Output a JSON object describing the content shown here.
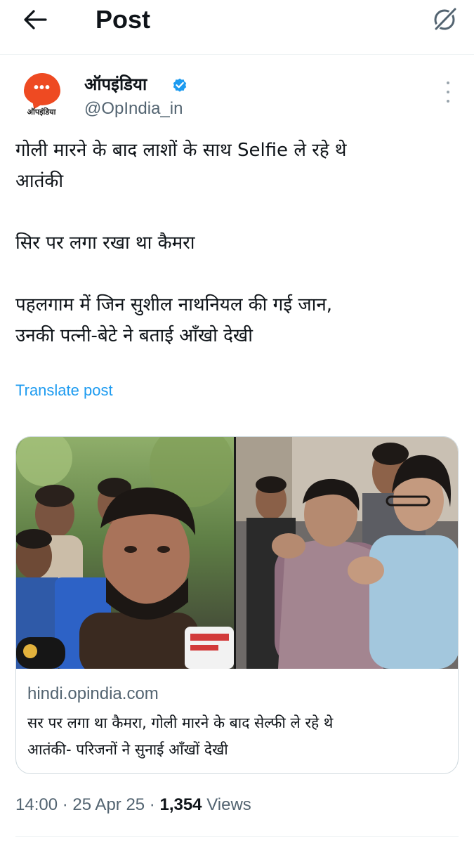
{
  "header": {
    "title": "Post"
  },
  "author": {
    "avatar_text": "ऑपइंडिया",
    "name": "ऑपइंडिया",
    "handle": "@OpIndia_in",
    "verified": true
  },
  "post": {
    "line1": "गोली मारने के बाद लाशों के साथ Selfie ले रहे थे",
    "line2": "आतंकी",
    "line3": "सिर पर लगा रखा था कैमरा",
    "line4": "पहलगाम में जिन सुशील नाथनियल की गई जान,",
    "line5": "उनकी पत्नी-बेटे ने बताई आँखो देखी",
    "translate": "Translate post"
  },
  "card": {
    "domain": "hindi.opindia.com",
    "title_line1": "सर पर लगा था कैमरा, गोली मारने के बाद सेल्फी ले रहे थे",
    "title_line2": "आतंकी- परिजनों ने सुनाई आँखों देखी"
  },
  "meta": {
    "time": "14:00",
    "sep1": " · ",
    "date": "25 Apr 25",
    "sep2": " · ",
    "views": "1,354",
    "views_label": " Views"
  },
  "colors": {
    "accent": "#1d9bf0",
    "brand_avatar": "#ee4a22",
    "secondary_text": "#536471"
  },
  "icons": {
    "back": "arrow-left-icon",
    "grok": "grok-icon",
    "verified": "verified-badge-icon",
    "more": "more-vertical-icon"
  }
}
